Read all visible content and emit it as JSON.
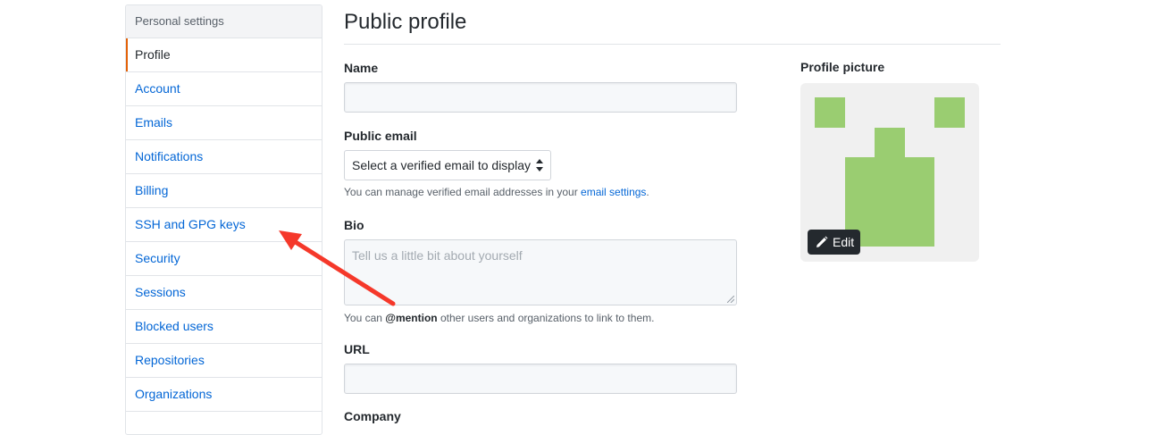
{
  "sidebar": {
    "header": "Personal settings",
    "items": [
      {
        "label": "Profile",
        "selected": true
      },
      {
        "label": "Account"
      },
      {
        "label": "Emails"
      },
      {
        "label": "Notifications"
      },
      {
        "label": "Billing"
      },
      {
        "label": "SSH and GPG keys"
      },
      {
        "label": "Security"
      },
      {
        "label": "Sessions"
      },
      {
        "label": "Blocked users"
      },
      {
        "label": "Repositories"
      },
      {
        "label": "Organizations"
      }
    ]
  },
  "main": {
    "title": "Public profile",
    "name_label": "Name",
    "name_value": "",
    "email_label": "Public email",
    "email_select_value": "Select a verified email to display",
    "email_note_prefix": "You can manage verified email addresses in your ",
    "email_note_link": "email settings",
    "email_note_suffix": ".",
    "bio_label": "Bio",
    "bio_placeholder": "Tell us a little bit about yourself",
    "bio_note_prefix": "You can ",
    "bio_note_mention": "@mention",
    "bio_note_suffix": " other users and organizations to link to them.",
    "url_label": "URL",
    "url_value": "",
    "company_label": "Company"
  },
  "profile_picture": {
    "label": "Profile picture",
    "edit_label": "Edit",
    "avatar_color": "#9acd71"
  },
  "annotation": {
    "arrow_color": "#f5382a"
  }
}
